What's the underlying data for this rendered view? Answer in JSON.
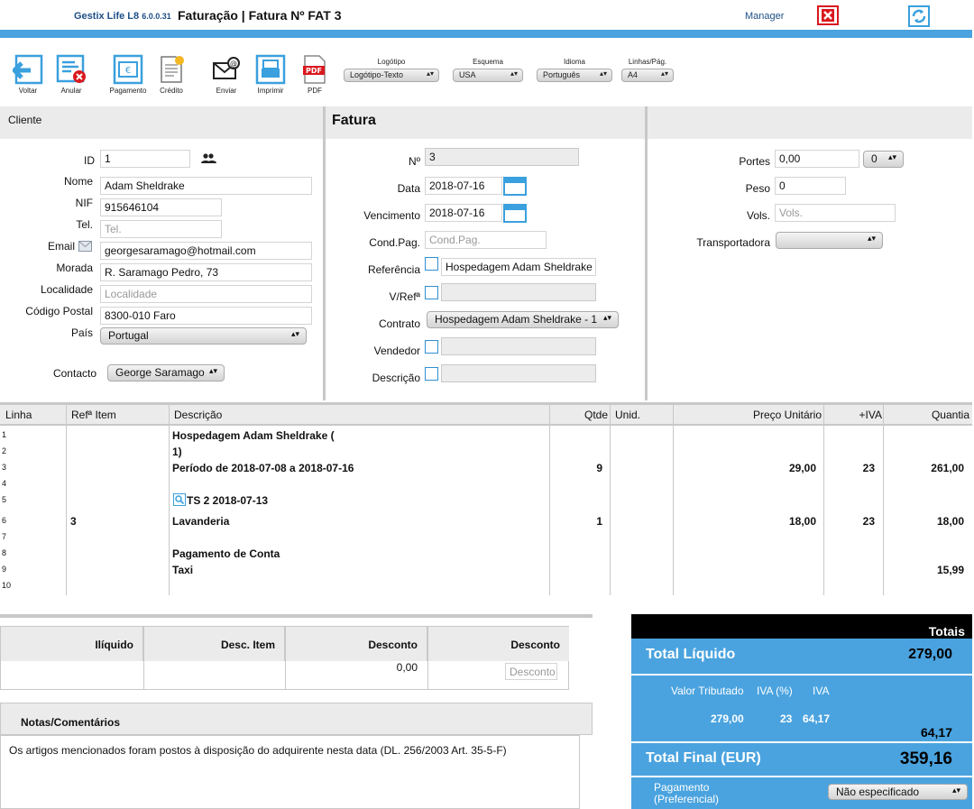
{
  "header": {
    "app_name": "Gestix Life L8",
    "version": "6.0.0.31",
    "title": "Faturação | Fatura Nº FAT 3",
    "user": "Manager"
  },
  "toolbar": {
    "buttons": [
      "Voltar",
      "Anular",
      "Pagamento",
      "Crédito",
      "Enviar",
      "Imprimir",
      "PDF"
    ],
    "pdf_icon_text": "PDF",
    "selects": [
      {
        "label": "Logótipo",
        "value": "Logótipo-Texto"
      },
      {
        "label": "Esquema",
        "value": "USA"
      },
      {
        "label": "Idioma",
        "value": "Português"
      },
      {
        "label": "Linhas/Pág.",
        "value": "A4"
      }
    ]
  },
  "cliente": {
    "title": "Cliente",
    "labels": {
      "id": "ID",
      "nome": "Nome",
      "nif": "NIF",
      "tel": "Tel.",
      "email": "Email",
      "morada": "Morada",
      "localidade": "Localidade",
      "codigo_postal": "Código Postal",
      "pais": "País",
      "contacto": "Contacto"
    },
    "values": {
      "id": "1",
      "nome": "Adam Sheldrake",
      "nif": "915646104",
      "tel": "",
      "email": "georgesaramago@hotmail.com",
      "morada": "R. Saramago Pedro, 73",
      "localidade": "",
      "codigo_postal": "8300-010 Faro",
      "pais": "Portugal",
      "contacto": "George Saramago"
    },
    "placeholders": {
      "tel": "Tel.",
      "localidade": "Localidade"
    }
  },
  "fatura": {
    "title": "Fatura",
    "labels": {
      "numero": "Nº",
      "data": "Data",
      "vencimento": "Vencimento",
      "cond_pag": "Cond.Pag.",
      "referencia": "Referência",
      "v_ref": "V/Refª",
      "contrato": "Contrato",
      "vendedor": "Vendedor",
      "descricao": "Descrição"
    },
    "values": {
      "numero": "3",
      "data": "2018-07-16",
      "vencimento": "2018-07-16",
      "cond_pag": "",
      "referencia": "Hospedagem Adam Sheldrake",
      "v_ref": "",
      "contrato": "Hospedagem Adam Sheldrake - 1",
      "vendedor": "",
      "descricao": ""
    },
    "placeholders": {
      "cond_pag": "Cond.Pag."
    }
  },
  "envio": {
    "labels": {
      "portes": "Portes",
      "peso": "Peso",
      "vols": "Vols.",
      "transportadora": "Transportadora"
    },
    "values": {
      "portes": "0,00",
      "portes_iva": "0",
      "peso": "0",
      "vols": "",
      "transportadora": ""
    },
    "placeholders": {
      "vols": "Vols."
    }
  },
  "items": {
    "headers": [
      "Linha",
      "Refª Item",
      "Descrição",
      "Qtde",
      "Unid.",
      "Preço Unitário",
      "+IVA",
      "Quantia"
    ],
    "line_numbers": [
      "1",
      "2",
      "3",
      "4",
      "5",
      "6",
      "7",
      "8",
      "9",
      "10"
    ],
    "rows": [
      {
        "desc": "Hospedagem Adam Sheldrake ("
      },
      {
        "desc": "1)"
      },
      {
        "desc": "Período de 2018-07-08 a 2018-07-16",
        "qty": "9",
        "price": "29,00",
        "iva": "23",
        "amount": "261,00"
      },
      {
        "desc": "TS 2 2018-07-13"
      },
      {
        "ref": "3",
        "desc": "Lavanderia",
        "qty": "1",
        "price": "18,00",
        "iva": "23",
        "amount": "18,00"
      },
      {
        "desc": "Pagamento de Conta"
      },
      {
        "desc": "Taxi",
        "amount": "15,99"
      }
    ]
  },
  "discounts": {
    "headers": [
      "Ilíquido",
      "Desc. Item",
      "Desconto",
      "Desconto"
    ],
    "desconto_value": "0,00",
    "desconto_placeholder": "Desconto"
  },
  "notes": {
    "title": "Notas/Comentários",
    "text": "Os artigos mencionados foram postos à disposição do adquirente nesta data (DL. 256/2003 Art. 35-5-F)"
  },
  "totals": {
    "title": "Totais",
    "liquido_label": "Total Líquido",
    "liquido_value": "279,00",
    "tax_headers": [
      "Valor Tributado",
      "IVA (%)",
      "IVA"
    ],
    "tax_row": [
      "279,00",
      "23",
      "64,17"
    ],
    "iva_total": "64,17",
    "final_label": "Total Final (EUR)",
    "final_value": "359,16",
    "pagamento_label_1": "Pagamento",
    "pagamento_label_2": "(Preferencial)",
    "pagamento_value": "Não especificado"
  },
  "colors": {
    "accent": "#4aa3df",
    "section_bg": "#ebebeb",
    "close_red": "#d9181e"
  }
}
